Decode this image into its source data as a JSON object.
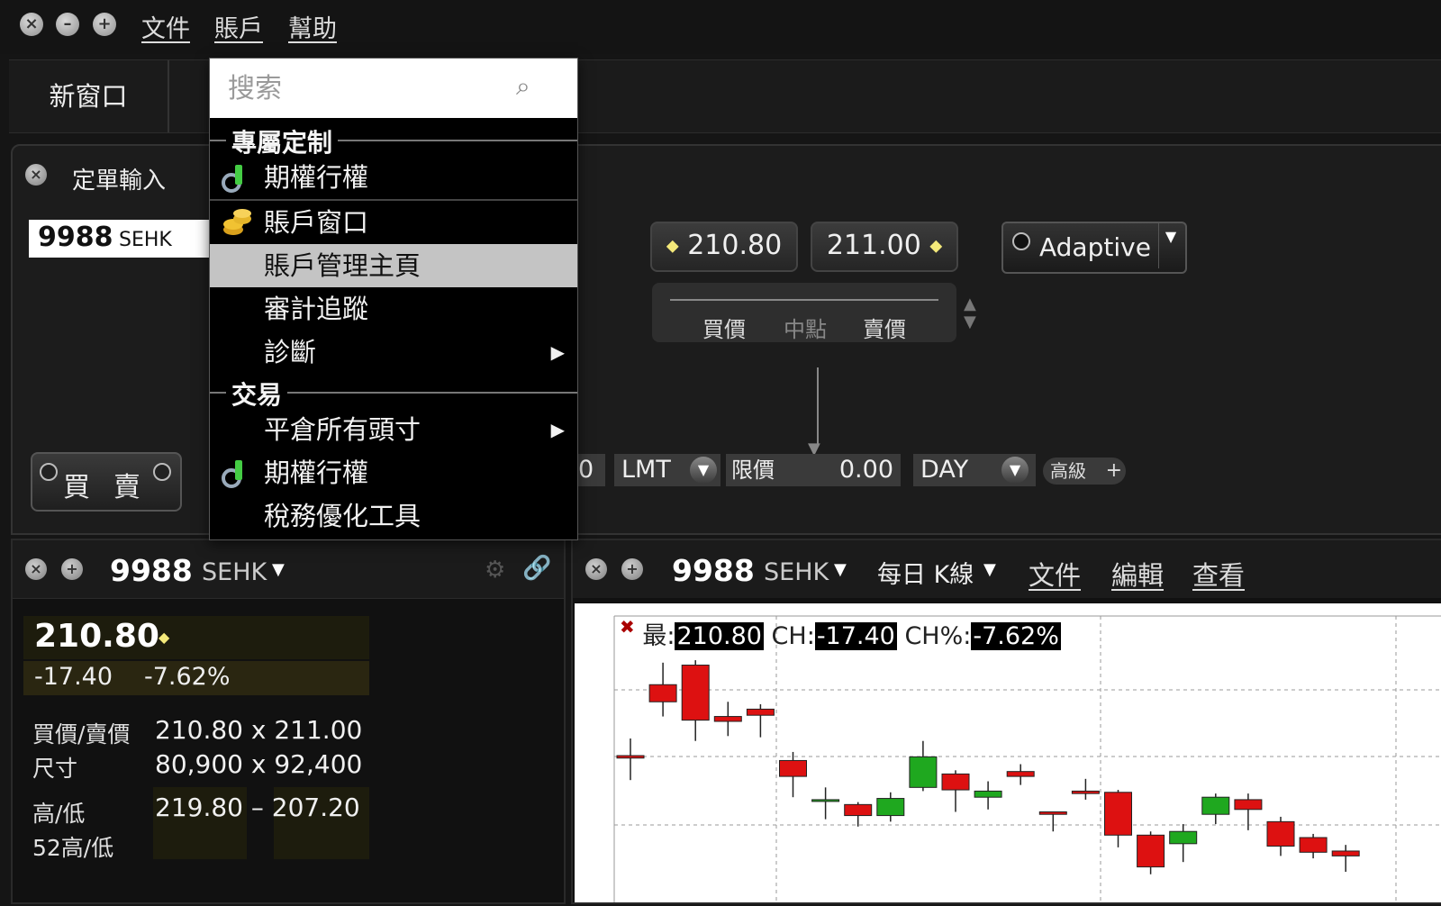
{
  "titlebar": {
    "menus": [
      "文件",
      "賬戶",
      "幫助"
    ]
  },
  "toolbar": {
    "new_window": "新窗口"
  },
  "order_entry": {
    "title": "定單輸入",
    "symbol": "9988",
    "exchange": "SEHK",
    "buy_label": "買",
    "sell_label": "賣",
    "bid_price": "210.80",
    "ask_price": "211.00",
    "slider_labels": [
      "買價",
      "中點",
      "賣價"
    ],
    "algo": "Adaptive",
    "qty_fragment": "0",
    "order_type": "LMT",
    "limit_label": "限價",
    "limit_value": "0.00",
    "tif": "DAY",
    "advanced": "高級"
  },
  "dropdown": {
    "search_placeholder": "搜索",
    "sections": {
      "custom": "專屬定制",
      "trading": "交易"
    },
    "items": {
      "options_exercise": "期權行權",
      "account_window": "賬戶窗口",
      "account_home": "賬戶管理主頁",
      "audit_trail": "審計追蹤",
      "diagnostics": "診斷",
      "close_all": "平倉所有頭寸",
      "options_exercise_2": "期權行權",
      "tax_tool": "稅務優化工具"
    }
  },
  "quote": {
    "symbol": "9988",
    "exchange": "SEHK",
    "last": "210.80",
    "change": "-17.40",
    "change_pct": "-7.62%",
    "bid_ask_label": "買價/賣價",
    "bid_ask_value": "210.80 x 211.00",
    "size_label": "尺寸",
    "size_value": "80,900 x 92,400",
    "hilo_label": "高/低",
    "hilo_value": "219.80 – 207.20",
    "wk52_label": "52高/低"
  },
  "chart": {
    "symbol": "9988",
    "exchange": "SEHK",
    "period": "每日 K線",
    "menus": [
      "文件",
      "編輯",
      "查看"
    ],
    "legend_last_label": "最:",
    "legend_last": "210.80",
    "legend_ch_label": "CH:",
    "legend_ch": "-17.40",
    "legend_chp_label": "CH%:",
    "legend_chp": "-7.62%",
    "colors": {
      "up": "#1fa81f",
      "down": "#dd1111"
    }
  },
  "chart_data": {
    "type": "candlestick",
    "title": "9988 SEHK",
    "candles": [
      {
        "o": 211.0,
        "h": 212.4,
        "l": 209.0,
        "c": 210.8
      },
      {
        "o": 216.8,
        "h": 218.6,
        "l": 214.2,
        "c": 215.4
      },
      {
        "o": 218.4,
        "h": 218.8,
        "l": 212.2,
        "c": 213.9
      },
      {
        "o": 214.2,
        "h": 215.4,
        "l": 212.6,
        "c": 213.8
      },
      {
        "o": 214.8,
        "h": 215.2,
        "l": 212.5,
        "c": 214.3
      },
      {
        "o": 210.6,
        "h": 211.3,
        "l": 207.6,
        "c": 209.3
      },
      {
        "o": 207.4,
        "h": 208.4,
        "l": 205.8,
        "c": 207.4
      },
      {
        "o": 207.0,
        "h": 207.2,
        "l": 205.2,
        "c": 206.1
      },
      {
        "o": 206.1,
        "h": 208.0,
        "l": 205.6,
        "c": 207.5
      },
      {
        "o": 208.4,
        "h": 212.2,
        "l": 208.1,
        "c": 210.9
      },
      {
        "o": 209.5,
        "h": 209.8,
        "l": 206.4,
        "c": 208.2
      },
      {
        "o": 207.6,
        "h": 208.9,
        "l": 206.6,
        "c": 208.1
      },
      {
        "o": 209.7,
        "h": 210.3,
        "l": 208.6,
        "c": 209.3
      },
      {
        "o": 206.4,
        "h": 206.4,
        "l": 204.8,
        "c": 206.2
      },
      {
        "o": 208.1,
        "h": 209.1,
        "l": 207.4,
        "c": 207.9
      },
      {
        "o": 208.0,
        "h": 208.2,
        "l": 203.5,
        "c": 204.5
      },
      {
        "o": 204.5,
        "h": 204.8,
        "l": 201.3,
        "c": 201.9
      },
      {
        "o": 203.8,
        "h": 205.4,
        "l": 202.3,
        "c": 204.8
      },
      {
        "o": 206.2,
        "h": 207.9,
        "l": 205.4,
        "c": 207.6
      },
      {
        "o": 207.4,
        "h": 207.9,
        "l": 204.9,
        "c": 206.6
      },
      {
        "o": 205.6,
        "h": 206.0,
        "l": 202.8,
        "c": 203.6
      },
      {
        "o": 204.3,
        "h": 204.6,
        "l": 202.6,
        "c": 203.1
      },
      {
        "o": 203.2,
        "h": 203.7,
        "l": 201.5,
        "c": 202.8
      }
    ]
  }
}
